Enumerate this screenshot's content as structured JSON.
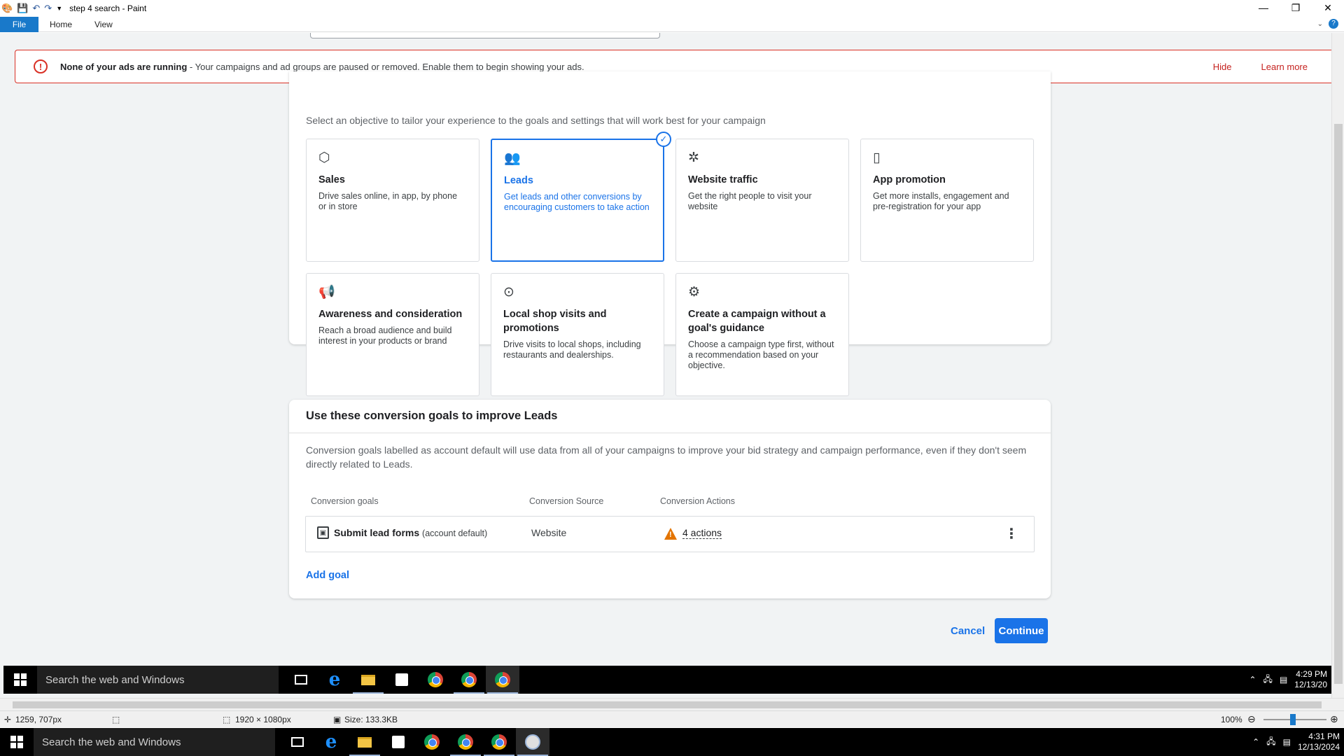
{
  "window": {
    "title": "step 4 search - Paint",
    "controls": {
      "minimize": "—",
      "restore": "❐",
      "close": "✕"
    }
  },
  "ribbon": {
    "file": "File",
    "home": "Home",
    "view": "View",
    "help": "?"
  },
  "alert": {
    "title": "None of your ads are running",
    "message": " - Your campaigns and ad groups are paused or removed. Enable them to begin showing your ads.",
    "hide": "Hide",
    "learn_more": "Learn more"
  },
  "objectives": {
    "subtitle": "Select an objective to tailor your experience to the goals and settings that will work best for your campaign",
    "items": [
      {
        "icon": "tag-icon",
        "glyph": "⬡",
        "name": "Sales",
        "desc": "Drive sales online, in app, by phone or in store"
      },
      {
        "icon": "people-icon",
        "glyph": "👥",
        "name": "Leads",
        "desc": "Get leads and other conversions by encouraging customers to take action",
        "selected": true
      },
      {
        "icon": "cursor-click-icon",
        "glyph": "✲",
        "name": "Website traffic",
        "desc": "Get the right people to visit your website"
      },
      {
        "icon": "phone-icon",
        "glyph": "▯",
        "name": "App promotion",
        "desc": "Get more installs, engagement and pre-registration for your app"
      },
      {
        "icon": "megaphone-icon",
        "glyph": "📢",
        "name": "Awareness and consideration",
        "desc": "Reach a broad audience and build interest in your products or brand"
      },
      {
        "icon": "location-pin-icon",
        "glyph": "⊙",
        "name": "Local shop visits and promotions",
        "desc": "Drive visits to local shops, including restaurants and dealerships."
      },
      {
        "icon": "gear-icon",
        "glyph": "⚙",
        "name": "Create a campaign without a goal's guidance",
        "desc": "Choose a campaign type first, without a recommendation based on your objective."
      }
    ]
  },
  "conversion": {
    "heading": "Use these conversion goals to improve Leads",
    "paragraph": "Conversion goals labelled as account default will use data from all of your campaigns to improve your bid strategy and campaign performance, even if they don't seem directly related to Leads.",
    "columns": {
      "goals": "Conversion goals",
      "source": "Conversion Source",
      "actions": "Conversion Actions"
    },
    "row": {
      "name": "Submit lead forms",
      "default": "(account default)",
      "source": "Website",
      "actions": "4 actions"
    },
    "add_goal": "Add goal"
  },
  "footer": {
    "cancel": "Cancel",
    "continue": "Continue"
  },
  "taskbar_inner": {
    "search": "Search the web and Windows",
    "time": "4:29 PM",
    "date": "12/13/20"
  },
  "taskbar_outer": {
    "search": "Search the web and Windows",
    "time": "4:31 PM",
    "date": "12/13/2024"
  },
  "statusbar": {
    "cursor": "1259, 707px",
    "dimensions": "1920 × 1080px",
    "size": "Size: 133.3KB",
    "zoom": "100%"
  }
}
